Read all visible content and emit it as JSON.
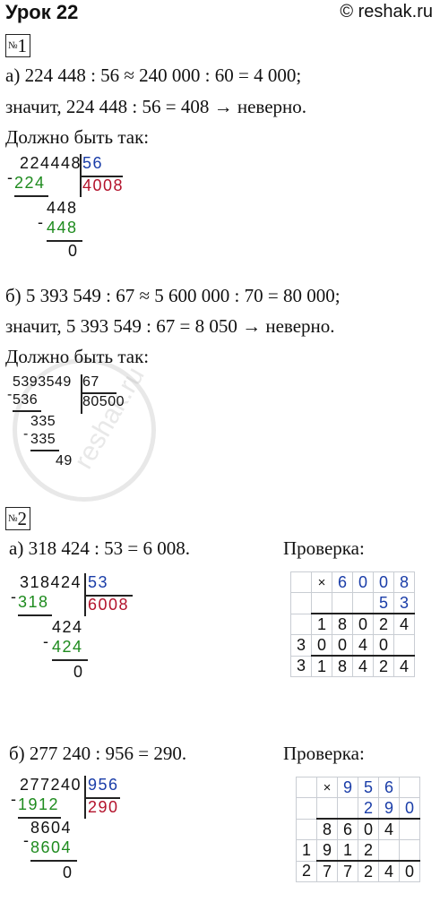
{
  "header": {
    "title": "Урок 22",
    "site": "© reshak.ru"
  },
  "task1": {
    "number": "1",
    "a_line1": "а) 224 448 : 56 ≈ 240 000 : 60 = 4 000;",
    "a_line2": "значит, 224 448 : 56 = 408 → неверно.",
    "a_line3": "Должно быть так:",
    "a_div": {
      "dividend": "224448",
      "divisor": "56",
      "sub1": "224",
      "quotient": "4008",
      "rem1": "448",
      "sub2": "448",
      "rem2": "0"
    },
    "b_line1": "б) 5 393 549 : 67 ≈ 5 600 000 : 70 = 80 000;",
    "b_line2": "значит, 5 393 549 : 67 = 8 050 → неверно.",
    "b_line3": "Должно быть так:",
    "b_div": {
      "dividend": "5393549",
      "divisor": "67",
      "sub1": "536",
      "quotient": "80500",
      "rem1": "335",
      "sub2": "335",
      "rem2": "49"
    }
  },
  "task2": {
    "number": "2",
    "a_line": "а) 318 424 : 53 = 6 008.",
    "a_check": "Проверка:",
    "a_div": {
      "dividend": "318424",
      "divisor": "53",
      "sub1": "318",
      "quotient": "6008",
      "rem1": "424",
      "sub2": "424",
      "rem2": "0"
    },
    "a_grid": [
      [
        "",
        "×",
        "6",
        "0",
        "0",
        "8"
      ],
      [
        "",
        "",
        "",
        "",
        "5",
        "3"
      ],
      [
        "",
        "1",
        "8",
        "0",
        "2",
        "4"
      ],
      [
        "3",
        "0",
        "0",
        "4",
        "0",
        ""
      ],
      [
        "3",
        "1",
        "8",
        "4",
        "2",
        "4"
      ]
    ],
    "b_line": "б) 277 240 : 956 = 290.",
    "b_check": "Проверка:",
    "b_div": {
      "dividend": "277240",
      "divisor": "956",
      "sub1": "1912",
      "quotient": "290",
      "rem1": "8604",
      "sub2": "8604",
      "rem2": "0"
    },
    "b_grid": [
      [
        "",
        "×",
        "9",
        "5",
        "6",
        ""
      ],
      [
        "",
        "",
        "",
        "2",
        "9",
        "0"
      ],
      [
        "",
        "8",
        "6",
        "0",
        "4",
        ""
      ],
      [
        "1",
        "9",
        "1",
        "2",
        "",
        ""
      ],
      [
        "2",
        "7",
        "7",
        "2",
        "4",
        "0"
      ]
    ]
  },
  "watermark": "reshak.ru"
}
